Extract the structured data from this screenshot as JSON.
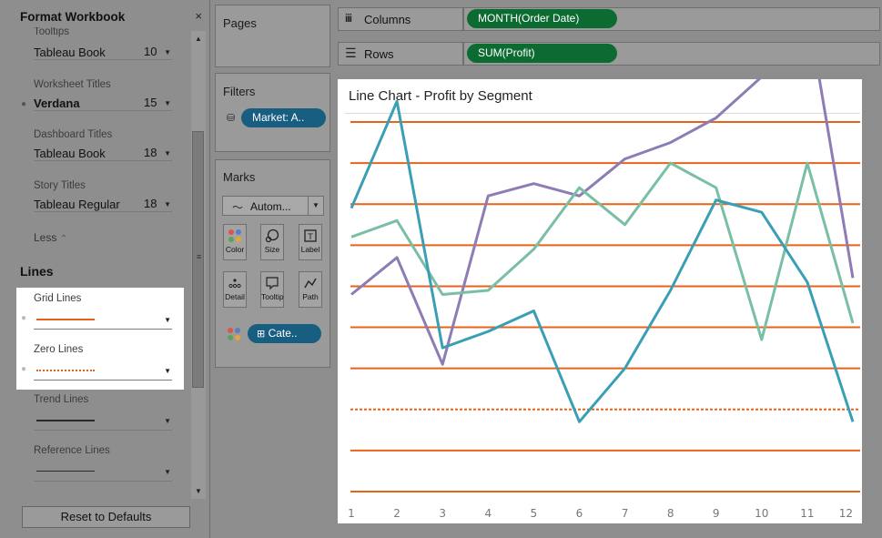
{
  "format_panel": {
    "title": "Format Workbook",
    "close": "×",
    "fonts": [
      {
        "label": "Tooltips",
        "font": "Tableau Book",
        "size": "10"
      },
      {
        "label": "Worksheet Titles",
        "font": "Verdana",
        "size": "15"
      },
      {
        "label": "Dashboard Titles",
        "font": "Tableau Book",
        "size": "18"
      },
      {
        "label": "Story Titles",
        "font": "Tableau Regular",
        "size": "18"
      }
    ],
    "less_label": "Less",
    "lines_header": "Lines",
    "lines": [
      {
        "label": "Grid Lines",
        "color": "#e8621a",
        "style": "solid"
      },
      {
        "label": "Zero Lines",
        "color": "#e8621a",
        "style": "dotted"
      },
      {
        "label": "Trend Lines",
        "color": "#2b2b2b",
        "style": "solid"
      },
      {
        "label": "Reference Lines",
        "color": "#2b2b2b",
        "style": "solid-thin"
      }
    ],
    "reset_label": "Reset to Defaults"
  },
  "pages": {
    "title": "Pages"
  },
  "filters": {
    "title": "Filters",
    "pill": "Market: A.."
  },
  "marks": {
    "title": "Marks",
    "type": "Autom...",
    "buttons": [
      {
        "label": "Color",
        "icon": "color-dots-icon"
      },
      {
        "label": "Size",
        "icon": "size-icon"
      },
      {
        "label": "Label",
        "icon": "label-icon"
      },
      {
        "label": "Detail",
        "icon": "detail-icon"
      },
      {
        "label": "Tooltip",
        "icon": "tooltip-icon"
      },
      {
        "label": "Path",
        "icon": "path-icon"
      }
    ],
    "color_pill": "Cate.."
  },
  "shelves": {
    "columns_label": "Columns",
    "columns_pill": "MONTH(Order Date)",
    "rows_label": "Rows",
    "rows_pill": "SUM(Profit)"
  },
  "chart_data": {
    "type": "line",
    "title": "Line Chart - Profit by Segment",
    "x": [
      1,
      2,
      3,
      4,
      5,
      6,
      7,
      8,
      9,
      10,
      11,
      12
    ],
    "x_tick_labels": [
      "1",
      "2",
      "3",
      "4",
      "5",
      "6",
      "7",
      "8",
      "9",
      "10",
      "11",
      "12"
    ],
    "ylim": [
      -7,
      2
    ],
    "gridlines": [
      2,
      1,
      0,
      -1,
      -2,
      -3,
      -4,
      -5,
      -6,
      -7
    ],
    "zero_line": -5,
    "grid_color": "#e8621a",
    "series": [
      {
        "color": "#8e7cb4",
        "values": [
          -2.2,
          -1.3,
          -3.9,
          0.2,
          0.5,
          0.2,
          1.1,
          1.5,
          2.1,
          3.1,
          4.8,
          -1.8
        ]
      },
      {
        "color": "#78bfa3",
        "values": [
          -0.8,
          -0.4,
          -2.2,
          -2.1,
          -1.1,
          0.4,
          -0.5,
          1.0,
          0.4,
          -3.3,
          1.0,
          -2.9
        ]
      },
      {
        "color": "#3a9fb5",
        "values": [
          -0.1,
          2.5,
          -3.5,
          -3.1,
          -2.6,
          -5.3,
          -4.0,
          -2.1,
          0.1,
          -0.2,
          -1.9,
          -5.3
        ]
      }
    ]
  }
}
